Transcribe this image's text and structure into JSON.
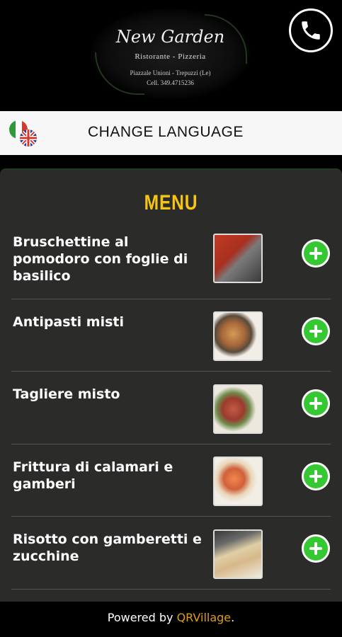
{
  "header": {
    "logo": {
      "name": "New Garden",
      "subtitle": "Ristorante - Pizzeria",
      "address": "Piazzale Unioni - Trepuzzi (Le)",
      "phone": "Cell. 349.4715236"
    },
    "phone_icon": "phone-icon"
  },
  "language_bar": {
    "label": "CHANGE LANGUAGE",
    "flags_icon": "italy-uk-flags-icon"
  },
  "menu": {
    "title": "MENU",
    "items": [
      {
        "name": "Bruschettine al pomodoro con foglie di basilico",
        "thumb_colors": [
          "#b8321e",
          "#6e6e6e"
        ]
      },
      {
        "name": "Antipasti misti",
        "thumb_colors": [
          "#c98a4a",
          "#f0ede6"
        ]
      },
      {
        "name": "Tagliere misto",
        "thumb_colors": [
          "#b44a3a",
          "#e8e4da"
        ]
      },
      {
        "name": "Frittura di calamari e gamberi",
        "thumb_colors": [
          "#e07a40",
          "#f1ede4"
        ]
      },
      {
        "name": "Risotto con gamberetti e zucchine",
        "thumb_colors": [
          "#d9c8a0",
          "#5a5a5a"
        ]
      }
    ]
  },
  "footer": {
    "prefix": "Powered by ",
    "brand": "QRVillage",
    "suffix": "."
  },
  "colors": {
    "menu_title": "#f6c514",
    "add_button": "#35c833",
    "brand_link": "#e29a1b",
    "panel_bg": "#2b2b2a"
  }
}
